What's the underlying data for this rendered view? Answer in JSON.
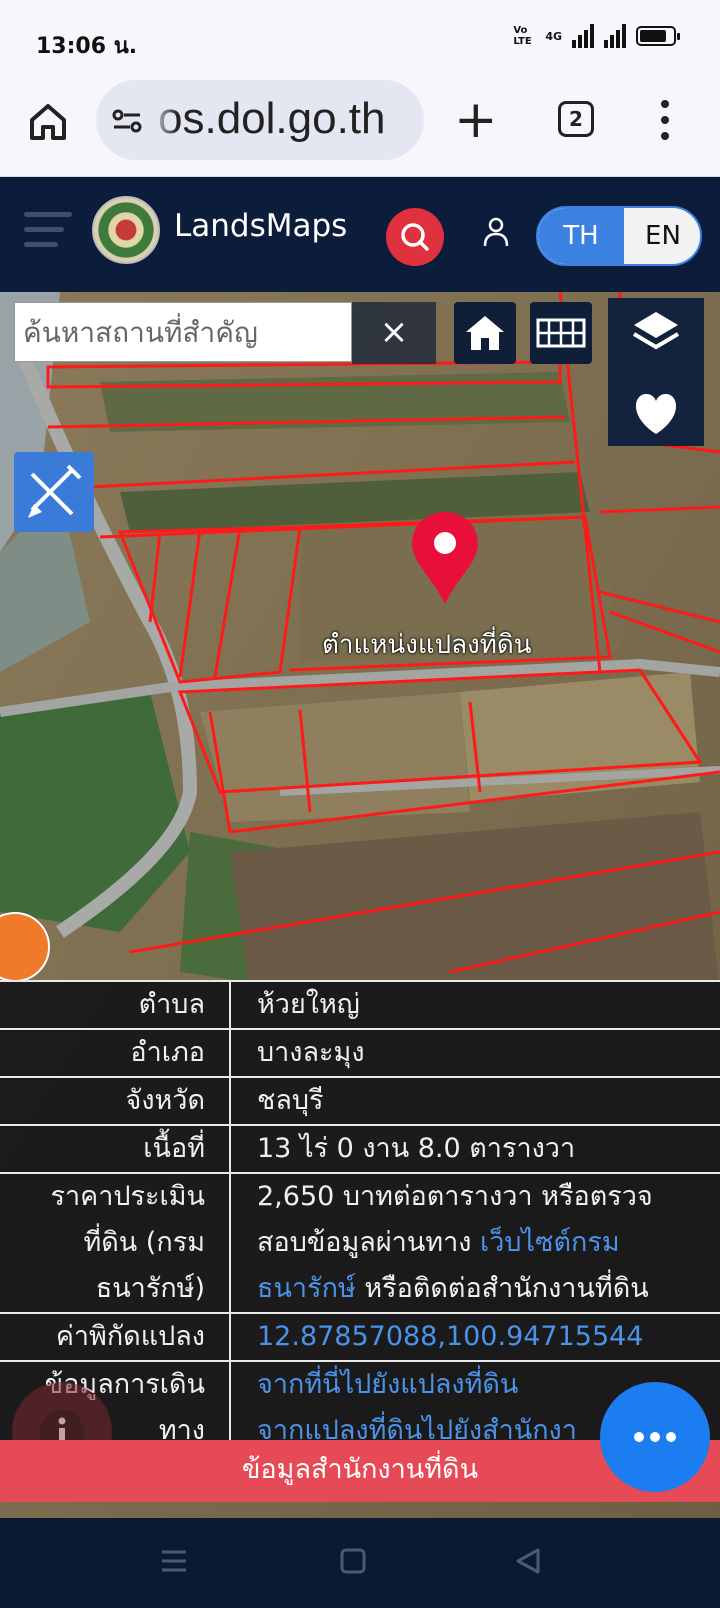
{
  "status": {
    "time": "13:06 น.",
    "network": "4G",
    "volte": "Vo LTE"
  },
  "browser": {
    "url_text": "os.dol.go.th",
    "tab_count": "2"
  },
  "header": {
    "title": "LandsMaps",
    "lang_th": "TH",
    "lang_en": "EN"
  },
  "map": {
    "search_placeholder": "ค้นหาสถานที่สำคัญ",
    "clear_label": "×",
    "pin_label": "ตำแหน่งแปลงที่ดิน"
  },
  "info": {
    "rows": [
      {
        "key": "ตำบล",
        "value": "ห้วยใหญ่"
      },
      {
        "key": "อำเภอ",
        "value": "บางละมุง"
      },
      {
        "key": "จังหวัด",
        "value": "ชลบุรี"
      },
      {
        "key": "เนื้อที่",
        "value": "13 ไร่ 0 งาน 8.0 ตารางวา"
      }
    ],
    "price_key_1": "ราคาประเมิน",
    "price_key_2": "ที่ดิน (กรม",
    "price_key_3": "ธนารักษ์)",
    "price_line_1": "2,650 บาทต่อตารางวา หรือตรวจ",
    "price_line_2_text": "สอบข้อมูลผ่านทาง ",
    "price_line_2_link": "เว็บไซต์กรม",
    "price_line_3_link": "ธนารักษ์",
    "price_line_3_text": " หรือติดต่อสำนักงานที่ดิน",
    "coord_key": "ค่าพิกัดแปลง",
    "coord_value": "12.87857088,100.94715544",
    "travel_key_1": "ข้อมูลการเดิน",
    "travel_key_2": "ทาง",
    "travel_link_1": "จากที่นี่ไปยังแปลงที่ดิน",
    "travel_link_2": "จากแปลงที่ดินไปยังสำนักงา",
    "office_button": "ข้อมูลสำนักงานที่ดิน"
  },
  "colors": {
    "header_bg": "#0b1d3a",
    "accent_red": "#e0313f",
    "accent_blue": "#3b82e0",
    "link": "#4a93e8"
  }
}
